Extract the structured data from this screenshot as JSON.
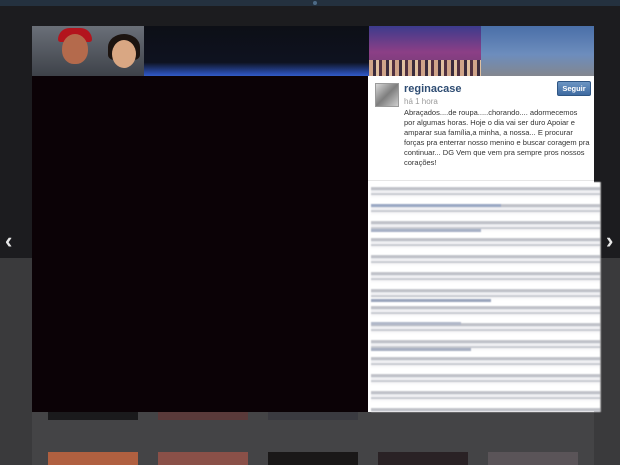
{
  "post": {
    "username": "reginacase",
    "time": "há 1 hora",
    "follow_label": "Seguir",
    "caption": "Abraçados....de roupa.....chorando.... adormecemos por algumas horas. Hoje o dia vai ser duro Apoiar e amparar sua família,a minha, a nossa... E procurar forças pra enterrar nosso menino e buscar coragem pra continuar... DG Vem que vem pra sempre pros nossos corações!"
  },
  "navigation": {
    "prev_icon": "‹",
    "next_icon": "›"
  },
  "colors": {
    "follow_button": "#4a76ab",
    "username": "#2f4d73",
    "photo_background": "#0b0206"
  }
}
